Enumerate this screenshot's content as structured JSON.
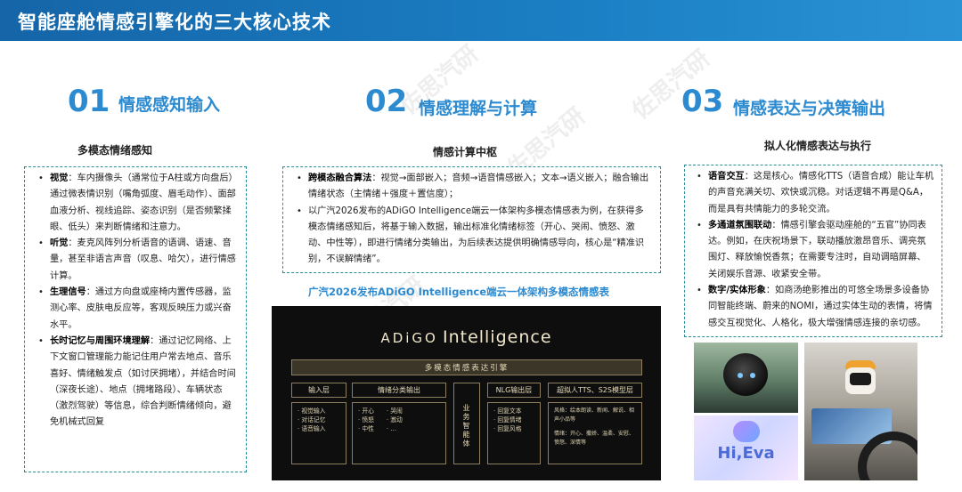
{
  "page": {
    "title": "智能座舱情感引擎化的三大核心技术",
    "watermark": "佐思汽研"
  },
  "sections": [
    {
      "number": "01",
      "heading": "情感感知输入",
      "subtitle": "多模态情绪感知",
      "items": [
        {
          "bold": "视觉",
          "text": "：车内摄像头（通常位于A柱或方向盘后）通过微表情识别（嘴角弧度、眉毛动作）、面部血液分析、视线追踪、姿态识别（是否频繁揉眼、低头）来判断情绪和注意力。"
        },
        {
          "bold": "听觉",
          "text": "：麦克风阵列分析语音的语调、语速、音量，甚至非语言声音（叹息、哈欠），进行情感计算。"
        },
        {
          "bold": "生理信号",
          "text": "：通过方向盘或座椅内置传感器，监测心率、皮肤电反应等，客观反映压力或兴奋水平。"
        },
        {
          "bold": "长时记忆与周围环境理解",
          "text": "：通过记忆网络、上下文窗口管理能力能记住用户常去地点、音乐喜好、情绪触发点（如讨厌拥堵），并结合时间（深夜长途）、地点（拥堵路段）、车辆状态（激烈驾驶）等信息，综合判断情绪倾向，避免机械式回复"
        }
      ]
    },
    {
      "number": "02",
      "heading": "情感理解与计算",
      "subtitle": "情感计算中枢",
      "items": [
        {
          "bold": "跨模态融合算法",
          "text": "：视觉→面部嵌入；音频→语音情感嵌入；文本→语义嵌入；融合输出情绪状态（主情绪＋强度＋置信度）；"
        },
        {
          "bold": "",
          "text": "以广汽2026发布的ADiGO Intelligence端云一体架构多模态情感表为例，在获得多模态情绪感知后，将基于输入数据，输出标准化情绪标签（开心、哭闹、愤怒、激动、中性等），即进行情绪分类输出，为后续表达提供明确情感导向，核心是“精准识别，不误解情绪”。"
        }
      ],
      "caption": "广汽2026发布ADiGO Intelligence端云一体架构多模态情感表"
    },
    {
      "number": "03",
      "heading": "情感表达与决策输出",
      "subtitle": "拟人化情感表达与执行",
      "items": [
        {
          "bold": "语音交互",
          "text": "：这是核心。情感化TTS（语音合成）能让车机的声音充满关切、欢快或沉稳。对话逻辑不再是Q&A，而是具有共情能力的多轮交流。"
        },
        {
          "bold": "多通道氛围联动",
          "text": "：情感引擎会驱动座舱的“五官”协同表达。例如，在庆祝场景下，联动播放激昂音乐、调亮氛围灯、释放愉悦香氛；在需要专注时，自动调暗屏幕、关闭娱乐音源、收紧安全带。"
        },
        {
          "bold": "数字/实体形象",
          "text": "：如商汤绝影推出的可悠全场景多设备协同智能终端、蔚来的NOMI，通过实体生动的表情，将情感交互视觉化、人格化，极大增强情感连接的亲切感。"
        }
      ]
    }
  ],
  "architecture": {
    "brand_a": "ADiGO",
    "brand_b": "Intelligence",
    "engine": "多模态情感表达引擎",
    "input_layer": {
      "label": "输入层",
      "items": [
        "· 视觉输入",
        "· 对话记忆",
        "· 语音输入"
      ]
    },
    "classify": {
      "label": "情绪分类输出",
      "col1": [
        "· 开心",
        "· 愤怒",
        "· 中性"
      ],
      "col2": [
        "· 哭闹",
        "· 激动",
        "· …"
      ]
    },
    "decision": {
      "label": "业务智能体"
    },
    "nlg": {
      "label": "NLG输出层",
      "items": [
        "· 回复文本",
        "· 回复情绪",
        "· 回复风格"
      ]
    },
    "tts": {
      "label": "超拟人TTS、S2S模型层",
      "row1": "风格：绘本朗读、新闻、解说、相声小品等",
      "row2": "情绪：开心、撒娇、温柔、安慰、愤怒、深情等"
    }
  },
  "photos": {
    "hieva_label": "Hi,Eva"
  }
}
